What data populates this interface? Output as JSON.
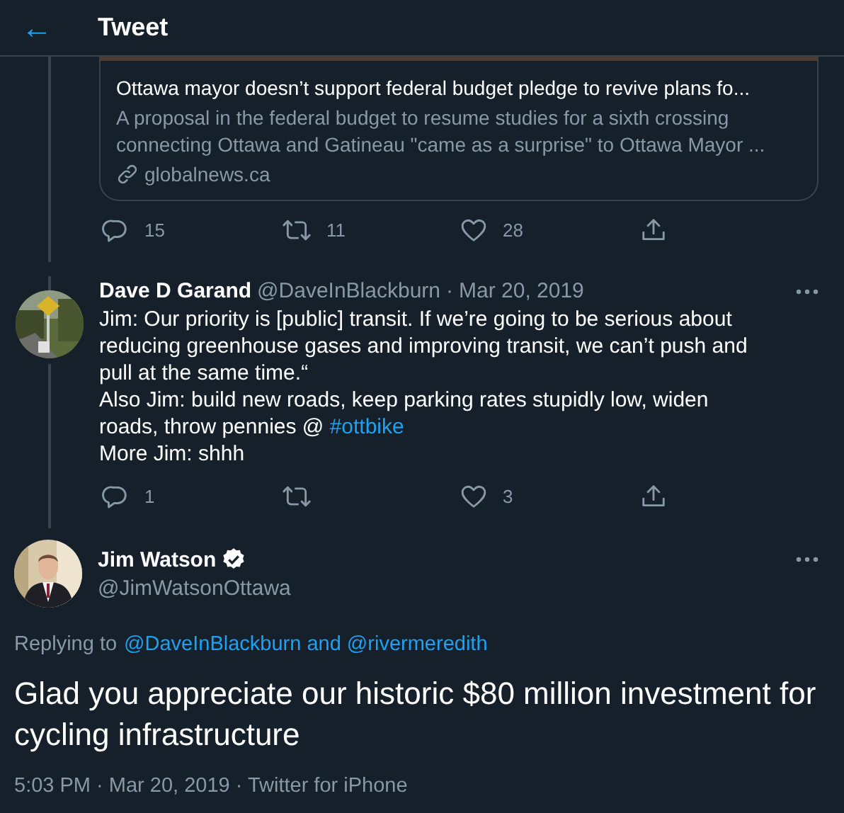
{
  "header": {
    "back_icon": "←",
    "title": "Tweet"
  },
  "link_card": {
    "title": "Ottawa mayor doesn’t support federal budget pledge to revive plans fo...",
    "description": "A proposal in the federal budget to resume studies for a sixth crossing connecting Ottawa and Gatineau \"came as a surprise\" to Ottawa Mayor ...",
    "domain": "globalnews.ca"
  },
  "parent_actions": {
    "replies": "15",
    "retweets": "11",
    "likes": "28"
  },
  "reply_tweet": {
    "name": "Dave D Garand",
    "handle": "@DaveInBlackburn",
    "separator": "·",
    "date": "Mar 20, 2019",
    "paragraphs": [
      {
        "text": "Jim: Our priority is [public] transit. If we’re going to be serious about reducing greenhouse gases and improving transit, we can’t push and pull at the same time.“"
      },
      {
        "text": "Also Jim: build new roads, keep parking rates stupidly low, widen roads, throw pennies @ ",
        "hashtag": "#ottbike"
      },
      {
        "text": "More Jim: shhh"
      }
    ],
    "actions": {
      "replies": "1",
      "likes": "3"
    }
  },
  "main_tweet": {
    "name": "Jim Watson",
    "verified": true,
    "handle": "@JimWatsonOttawa",
    "replying_prefix": "Replying to",
    "replying_to": "@DaveInBlackburn and @rivermeredith",
    "text": "Glad you appreciate our historic $80 million investment for cycling infrastructure",
    "meta": "5:03 PM · Mar 20, 2019 · Twitter for iPhone"
  }
}
